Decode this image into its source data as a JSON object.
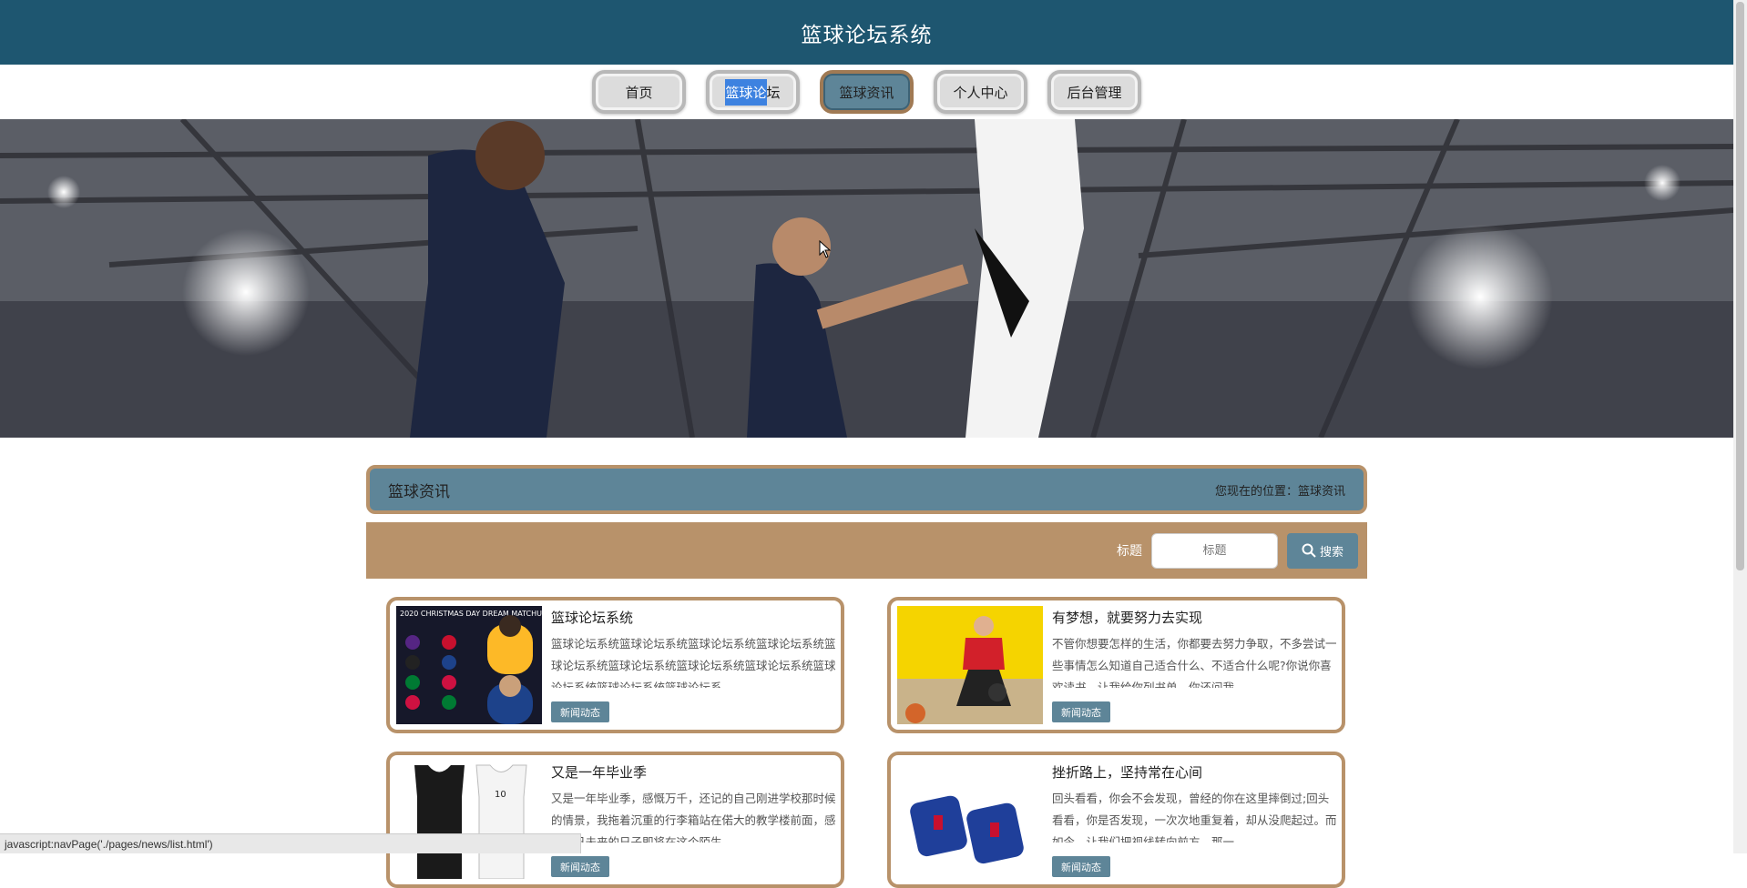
{
  "header": {
    "title": "篮球论坛系统"
  },
  "nav": {
    "items": [
      {
        "label": "首页"
      },
      {
        "label": "篮球论坛"
      },
      {
        "label": "篮球资讯"
      },
      {
        "label": "个人中心"
      },
      {
        "label": "后台管理"
      }
    ],
    "active_index": 2
  },
  "section": {
    "title": "篮球资讯",
    "breadcrumb_prefix": "您现在的位置：",
    "breadcrumb_current": "篮球资讯"
  },
  "search": {
    "label": "标题",
    "placeholder": "标题",
    "button_label": "搜索"
  },
  "news": [
    {
      "title": "篮球论坛系统",
      "text": "篮球论坛系统篮球论坛系统篮球论坛系统篮球论坛系统篮球论坛系统篮球论坛系统篮球论坛系统篮球论坛系统篮球论坛系统篮球论坛系统篮球论坛系…",
      "tag": "新闻动态",
      "thumb_text": "2020 CHRISTMAS DAY DREAM MATCHUPS"
    },
    {
      "title": "有梦想，就要努力去实现",
      "text": "不管你想要怎样的生活，你都要去努力争取，不多尝试一些事情怎么知道自己适合什么、不适合什么呢?你说你喜欢读书，让我给你列书单，你还问我…",
      "tag": "新闻动态"
    },
    {
      "title": "又是一年毕业季",
      "text": "又是一年毕业季，感慨万千，还记的自己刚进学校那时候的情景，我拖着沉重的行李箱站在偌大的教学楼前面，感叹自己未来的日子即将在这个陌生…",
      "tag": "新闻动态"
    },
    {
      "title": "挫折路上，坚持常在心间",
      "text": "回头看看，你会不会发现，曾经的你在这里摔倒过;回头看看，你是否发现，一次次地重复着，却从没爬起过。而如今，让我们把视线转向前方，那一…",
      "tag": "新闻动态"
    }
  ],
  "statusbar": {
    "url": "javascript:navPage('./pages/news/list.html')"
  },
  "colors": {
    "header_bg": "#1e5670",
    "accent_blue": "#5e8598",
    "accent_tan": "#b8926a"
  }
}
